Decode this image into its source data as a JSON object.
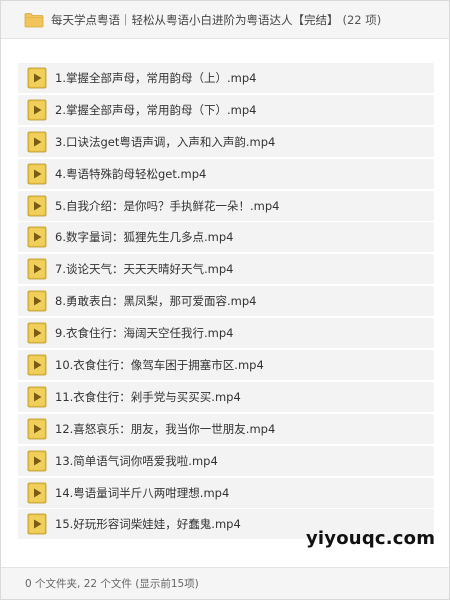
{
  "header": {
    "folder_icon": "folder-icon",
    "title": "每天学点粤语｜轻松从粤语小白进阶为粤语达人【完结】",
    "count": "(22 项)"
  },
  "files": [
    {
      "name": "1.掌握全部声母，常用韵母（上）.mp4",
      "icon": "video-file-icon"
    },
    {
      "name": "2.掌握全部声母，常用韵母（下）.mp4",
      "icon": "video-file-icon"
    },
    {
      "name": "3.口诀法get粤语声调，入声和入声韵.mp4",
      "icon": "video-file-icon"
    },
    {
      "name": "4.粤语特殊韵母轻松get.mp4",
      "icon": "video-file-icon"
    },
    {
      "name": "5.自我介绍：是你吗？手执鲜花一朵！.mp4",
      "icon": "video-file-icon"
    },
    {
      "name": "6.数字量词：狐狸先生几多点.mp4",
      "icon": "video-file-icon"
    },
    {
      "name": "7.谈论天气：天天天晴好天气.mp4",
      "icon": "video-file-icon"
    },
    {
      "name": "8.勇敢表白：黑凤梨，那可爱面容.mp4",
      "icon": "video-file-icon"
    },
    {
      "name": "9.衣食住行：海阔天空任我行.mp4",
      "icon": "video-file-icon"
    },
    {
      "name": "10.衣食住行：像驾车困于拥塞市区.mp4",
      "icon": "video-file-icon"
    },
    {
      "name": "11.衣食住行：剁手党与买买买.mp4",
      "icon": "video-file-icon"
    },
    {
      "name": "12.喜怒哀乐：朋友，我当你一世朋友.mp4",
      "icon": "video-file-icon"
    },
    {
      "name": "13.简单语气词你唔爱我啦.mp4",
      "icon": "video-file-icon"
    },
    {
      "name": "14.粤语量词半斤八两咁理想.mp4",
      "icon": "video-file-icon"
    },
    {
      "name": "15.好玩形容词柴娃娃，好蠢鬼.mp4",
      "icon": "video-file-icon"
    }
  ],
  "footer": {
    "summary": "0 个文件夹, 22 个文件 (显示前15项)"
  },
  "watermark": "yiyouqc.com",
  "colors": {
    "header_bg": "#f5f5f5",
    "row_bg": "#f3f3f3",
    "folder": "#f2c55c",
    "video_icon": "#e8c44c",
    "play_triangle": "#7a5c12"
  }
}
